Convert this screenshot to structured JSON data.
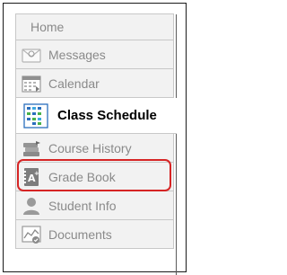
{
  "nav": {
    "items": [
      {
        "label": "Home",
        "icon": "home",
        "active": false
      },
      {
        "label": "Messages",
        "icon": "envelope-icon",
        "active": false
      },
      {
        "label": "Calendar",
        "icon": "calendar-icon",
        "active": false
      },
      {
        "label": "Class Schedule",
        "icon": "class-schedule-grid-icon",
        "active": true
      },
      {
        "label": "Course History",
        "icon": "stacked-books-icon",
        "active": false
      },
      {
        "label": "Grade Book",
        "icon": "grade-book-icon",
        "active": false,
        "highlighted": true
      },
      {
        "label": "Student Info",
        "icon": "person-icon",
        "active": false
      },
      {
        "label": "Documents",
        "icon": "documents-chart-icon",
        "active": false
      }
    ]
  },
  "colors": {
    "highlight": "#d62424",
    "inactive_text": "#8a8a8a",
    "active_text": "#000000"
  }
}
